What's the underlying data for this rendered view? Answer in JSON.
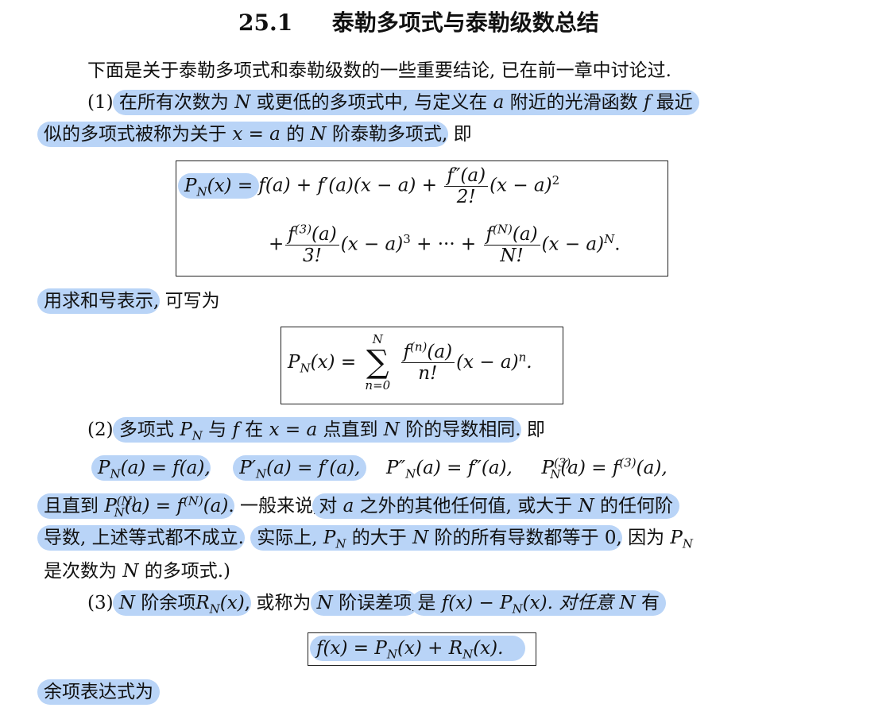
{
  "heading": {
    "number": "25.1",
    "title": "泰勒多项式与泰勒级数总结"
  },
  "intro": "下面是关于泰勒多项式和泰勒级数的一些重要结论, 已在前一章中讨论过.",
  "item1": {
    "marker": "(1)",
    "hl_a": "在所有次数为",
    "var_N": "N",
    "hl_b": "或更低的多项式中, 与定义在",
    "var_a": "a",
    "hl_c": "附近的光滑函数",
    "var_f": "f",
    "hl_d": "最近",
    "hl_e": "似的多项式被称为关于",
    "eq_xa": "x = a",
    "hl_f": "的",
    "var_N2": "N",
    "hl_g": "阶泰勒多项式",
    "tail": ", 即"
  },
  "formula1": {
    "lhs": "P",
    "lhs_sub": "N",
    "lhs_arg": "(x) =",
    "row1": "f(a) + f′(a)(x − a) +",
    "frac1_num": "f″(a)",
    "frac1_den": "2!",
    "row1_end": "(x − a)",
    "pow2": "2",
    "plus": "+",
    "frac2_num": "f",
    "frac2_num_sup": "(3)",
    "frac2_num_arg": "(a)",
    "frac2_den": "3!",
    "mid": "(x − a)",
    "pow3": "3",
    "dots": "+ ··· +",
    "frac3_num": "f",
    "frac3_num_sup": "(N)",
    "frac3_num_arg": "(a)",
    "frac3_den": "N!",
    "end": "(x − a)",
    "powN": "N",
    "period": "."
  },
  "sum_intro": {
    "hl": "用求和号表示",
    "tail": ", 可写为"
  },
  "formula2": {
    "lhs": "P",
    "lhs_sub": "N",
    "lhs_arg": "(x) =",
    "upper": "N",
    "sigma": "∑",
    "lower": "n=0",
    "num": "f",
    "num_sup": "(n)",
    "num_arg": "(a)",
    "den": "n!",
    "rest": "(x − a)",
    "pown": "n",
    "period": "."
  },
  "item2": {
    "marker": "(2)",
    "hl": "多项式",
    "P": "P",
    "Psub": "N",
    "yu": "与",
    "f": "f",
    "zai": "在",
    "eq": "x = a",
    "pt": "点直到",
    "N": "N",
    "rest": "阶的导数相同",
    "tail": ". 即"
  },
  "eqs2": {
    "e1": "P",
    "e1_sub": "N",
    "e1_rest": "(a) = f(a)",
    "c1": ",",
    "e2": "P′",
    "e2_sub": "N",
    "e2_rest": "(a) = f′(a),",
    "e3": "P″",
    "e3_sub": "N",
    "e3_rest": "(a) = f″(a),",
    "e4": "P",
    "e4_sup": "(3)",
    "e4_sub": "N",
    "e4_mid": "(a) = f",
    "e4_sup2": "(3)",
    "e4_end": "(a),"
  },
  "line_n": {
    "hl_a": "且直到",
    "P": "P",
    "Psup": "(N)",
    "Psub": "N",
    "eq": "(a) = f",
    "fsup": "(N)",
    "arg": "(a)",
    "plain": ". 一般来说,",
    "hl_b": "对",
    "a": "a",
    "hl_c": "之外的其他任何值, 或大于",
    "N": "N",
    "hl_d": "的任何阶"
  },
  "line_d": {
    "hl_a": "导数, 上述等式都不成立",
    "plain": ". (",
    "hl_b": "实际上,",
    "P": "P",
    "Psub": "N",
    "hl_c": "的大于",
    "N": "N",
    "hl_d": "阶的所有导数都等于",
    "zero": "0",
    "tail": ", 因为",
    "P2": "P",
    "P2sub": "N"
  },
  "line_e": {
    "a": "是次数为",
    "N": "N",
    "b": "的多项式.)"
  },
  "item3": {
    "marker": "(3)",
    "N1": "N",
    "hl_a": "阶余项",
    "R": "R",
    "Rsub": "N",
    "Rarg": "(x)",
    "plain1": ", 或称为",
    "N2": "N",
    "hl_b": "阶误差项",
    "plain2": ",",
    "hl_c": "是",
    "expr": "f(x) − P",
    "expr_sub": "N",
    "expr_end": "(x). 对任意",
    "N3": "N",
    "you": "有"
  },
  "formula3": {
    "a": "f(x) = P",
    "sub1": "N",
    "b": "(x) + R",
    "sub2": "N",
    "c": "(x)."
  },
  "remainder": {
    "hl": "余项表达式为"
  },
  "colors": {
    "highlight": "#b9d4f7",
    "text": "#111111",
    "border": "#222222"
  }
}
